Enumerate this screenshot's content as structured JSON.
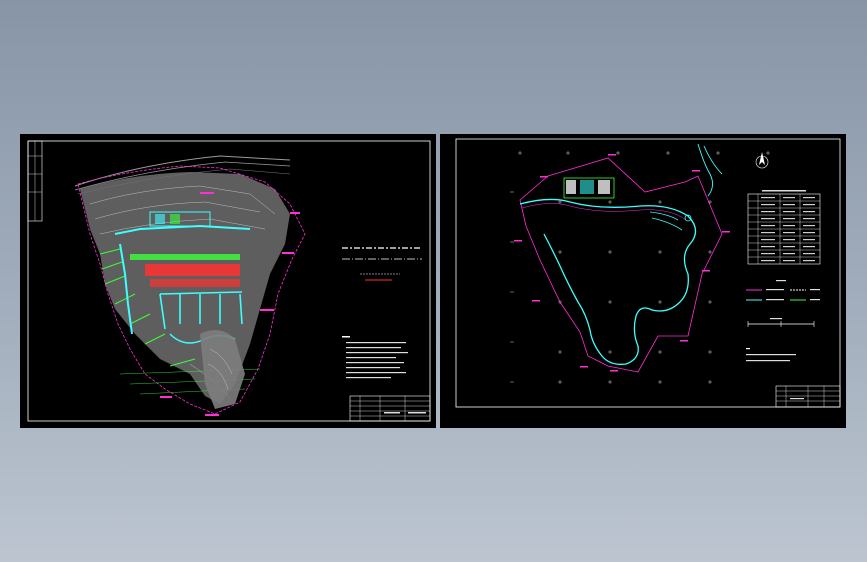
{
  "colors": {
    "background_top": "#8895a7",
    "background_bottom": "#bcc5d0",
    "cad_background": "#000000",
    "magenta": "#ff2fd4",
    "cyan": "#3dffff",
    "green": "#39ff3a",
    "red": "#ff3030",
    "yellow": "#ffff3a",
    "gray": "#8d8d8d",
    "white": "#ffffff"
  },
  "left_drawing": {
    "name": "site-plan-drawing",
    "title_block_rows": 5
  },
  "right_drawing": {
    "name": "boundary-plan-drawing",
    "legend_rows": 10,
    "title_block_rows": 4
  },
  "icons": {
    "north_arrow": "north-arrow-icon"
  }
}
